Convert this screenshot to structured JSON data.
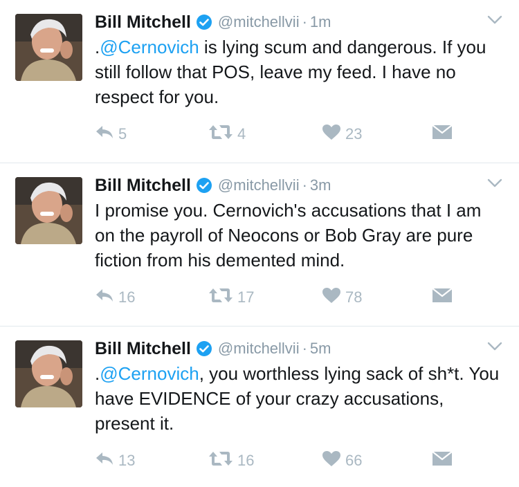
{
  "colors": {
    "accent": "#1da1f2",
    "muted": "#8899a6",
    "icon": "#aab8c2",
    "text": "#14171a"
  },
  "tweets": [
    {
      "name": "Bill Mitchell",
      "handle": "@mitchellvii",
      "sep": "·",
      "time": "1m",
      "text_pre": ".",
      "mention": "@Cernovich",
      "text_post": " is lying scum and dangerous.  If you still follow that POS, leave my feed.  I have no respect for you.",
      "replies": "5",
      "retweets": "4",
      "likes": "23"
    },
    {
      "name": "Bill Mitchell",
      "handle": "@mitchellvii",
      "sep": "·",
      "time": "3m",
      "text_pre": "I promise you.  Cernovich's accusations that I am on the payroll of Neocons or Bob Gray are pure fiction from his demented mind.",
      "mention": "",
      "text_post": "",
      "replies": "16",
      "retweets": "17",
      "likes": "78"
    },
    {
      "name": "Bill Mitchell",
      "handle": "@mitchellvii",
      "sep": "·",
      "time": "5m",
      "text_pre": ".",
      "mention": "@Cernovich",
      "text_post": ", you worthless lying sack of sh*t.  You have EVIDENCE of your crazy accusations, present it.",
      "replies": "13",
      "retweets": "16",
      "likes": "66"
    }
  ]
}
